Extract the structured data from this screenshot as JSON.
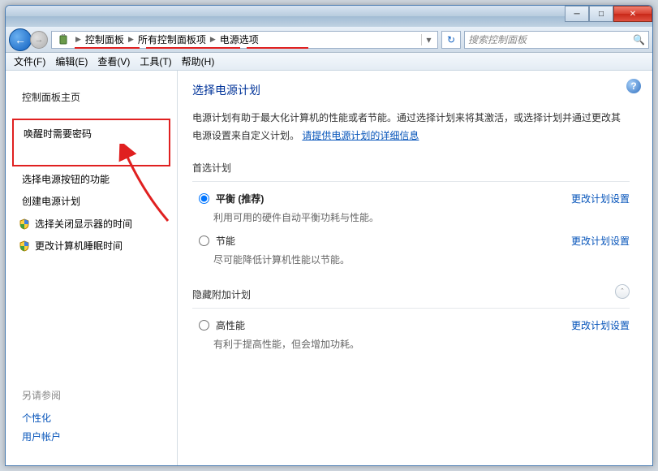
{
  "breadcrumb": [
    "控制面板",
    "所有控制面板项",
    "电源选项"
  ],
  "search_placeholder": "搜索控制面板",
  "menu": {
    "file": "文件(F)",
    "edit": "编辑(E)",
    "view": "查看(V)",
    "tools": "工具(T)",
    "help": "帮助(H)"
  },
  "sidebar": {
    "home": "控制面板主页",
    "items": [
      "唤醒时需要密码",
      "选择电源按钮的功能",
      "创建电源计划"
    ],
    "shield_items": [
      "选择关闭显示器的时间",
      "更改计算机睡眠时间"
    ],
    "see_also": "另请参阅",
    "see_also_links": [
      "个性化",
      "用户帐户"
    ]
  },
  "main": {
    "title": "选择电源计划",
    "desc1": "电源计划有助于最大化计算机的性能或者节能。通过选择计划来将其激活，或选择计划并通过更改其电源设置来自定义计划。",
    "desc_link": "请提供电源计划的详细信息",
    "pref_header": "首选计划",
    "plan_balanced": {
      "label": "平衡 (推荐)",
      "sub": "利用可用的硬件自动平衡功耗与性能。"
    },
    "plan_save": {
      "label": "节能",
      "sub": "尽可能降低计算机性能以节能。"
    },
    "hidden_header": "隐藏附加计划",
    "plan_high": {
      "label": "高性能",
      "sub": "有利于提高性能，但会增加功耗。"
    },
    "change_link": "更改计划设置"
  }
}
